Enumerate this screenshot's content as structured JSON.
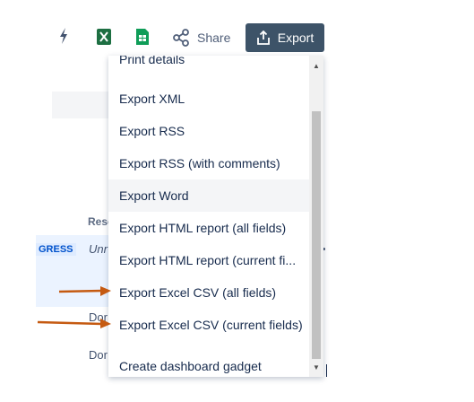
{
  "toolbar": {
    "icons": [
      "bolt-icon",
      "excel-icon",
      "sheets-icon"
    ],
    "share_label": "Share",
    "export_label": "Export"
  },
  "background": {
    "resolution_header": "Reso",
    "status": "GRESS",
    "resolution_values": [
      "Unr",
      "Dor",
      "Dor"
    ],
    "fragment_n": "n"
  },
  "menu": {
    "items": [
      "Print details",
      "Export XML",
      "Export RSS",
      "Export RSS (with comments)",
      "Export Word",
      "Export HTML report (all fields)",
      "Export HTML report (current fi...",
      "Export Excel CSV (all fields)",
      "Export Excel CSV (current fields)",
      "Create dashboard gadget"
    ],
    "hovered_item": "Export Word"
  },
  "colors": {
    "export_button": "#3d5368",
    "annotation_arrow": "#c55a11",
    "excel_green": "#1d6f42",
    "sheets_green": "#0f9d58"
  }
}
